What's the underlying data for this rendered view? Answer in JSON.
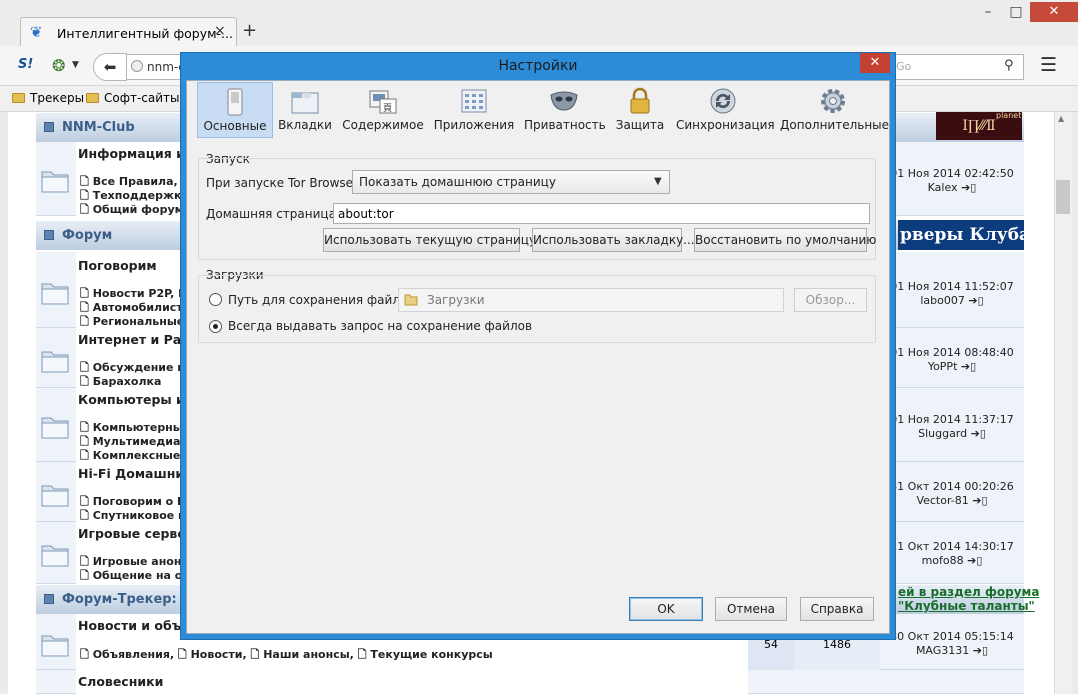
{
  "browser": {
    "tab_title": "Интеллигентный форум-...",
    "tab_close": "×",
    "new_tab": "+",
    "win_min": "–",
    "win_max": "□",
    "win_close": "✕",
    "site_icon_text": "S!",
    "url": "nnm-c",
    "search_placeholder": "Go",
    "bookmarks": [
      "Трекеры",
      "Софт-сайты"
    ]
  },
  "forum": {
    "categories": [
      "NNM-Club",
      "Форум",
      "Форум-Трекер: "
    ],
    "banner_a": "Ⅰ∏⁄⁄⁄Ⅱ",
    "banner_a_small": "planet",
    "banner_b": "рверы Клуба",
    "promo_line1": "ей в раздел форума",
    "promo_line2": "\"Клубные таланты\"",
    "rows": [
      {
        "title": "Информация и п",
        "subs": [
          "Все Правила, ",
          "Техподдержк",
          "Общий форум"
        ],
        "date": "01 Ноя 2014 02:42:50",
        "user": "Kalex"
      },
      {
        "title": "Поговорим",
        "subs": [
          "Новости P2P, К",
          "Автомобилист",
          "Региональные"
        ],
        "date": "01 Ноя 2014 11:52:07",
        "user": "labo007"
      },
      {
        "title": "Интернет и Разн",
        "subs": [
          "Обсуждение п",
          "Барахолка"
        ],
        "date": "01 Ноя 2014 08:48:40",
        "user": "YoPPt"
      },
      {
        "title": "Компьютеры и г",
        "subs": [
          "Компьютерны",
          "Мультимедиа,",
          "Комплексные"
        ],
        "date": "01 Ноя 2014 11:37:17",
        "user": "Sluggard"
      },
      {
        "title": "Hi-Fi Домашний",
        "subs": [
          "Поговорим о Н",
          "Спутниковое и"
        ],
        "date": "31 Окт 2014 00:20:26",
        "user": "Vector-81"
      },
      {
        "title": "Игровые сервер",
        "subs": [
          "Игровые анонс",
          "Общение на ок"
        ],
        "date": "21 Окт 2014 14:30:17",
        "user": "mofo88"
      },
      {
        "title": "Новости и объя",
        "subs": [
          "Объявления, ",
          "Новости, ",
          "Наши анонсы, ",
          "Текущие конкурсы"
        ],
        "date": "30 Окт 2014 05:15:14",
        "user": "MAG3131",
        "topics": "54",
        "posts": "1486"
      },
      {
        "title": "Словесники",
        "subs": [],
        "date": "",
        "user": ""
      }
    ]
  },
  "dialog": {
    "title": "Настройки",
    "close": "✕",
    "tabs": [
      "Основные",
      "Вкладки",
      "Содержимое",
      "Приложения",
      "Приватность",
      "Защита",
      "Синхронизация",
      "Дополнительные"
    ],
    "startup": {
      "group": "Запуск",
      "on_start_label": "При запуске Tor Browser:",
      "on_start_value": "Показать домашнюю страницу",
      "home_label": "Домашняя страница:",
      "home_value": "about:tor",
      "btn_current": "Использовать текущую страницу",
      "btn_bookmark": "Использовать закладку...",
      "btn_default": "Восстановить по умолчанию"
    },
    "downloads": {
      "group": "Загрузки",
      "save_path_label": "Путь для сохранения файлов",
      "save_path_value": "Загрузки",
      "browse": "Обзор...",
      "always_ask": "Всегда выдавать запрос на сохранение файлов"
    },
    "ok": "OK",
    "cancel": "Отмена",
    "help": "Справка"
  }
}
